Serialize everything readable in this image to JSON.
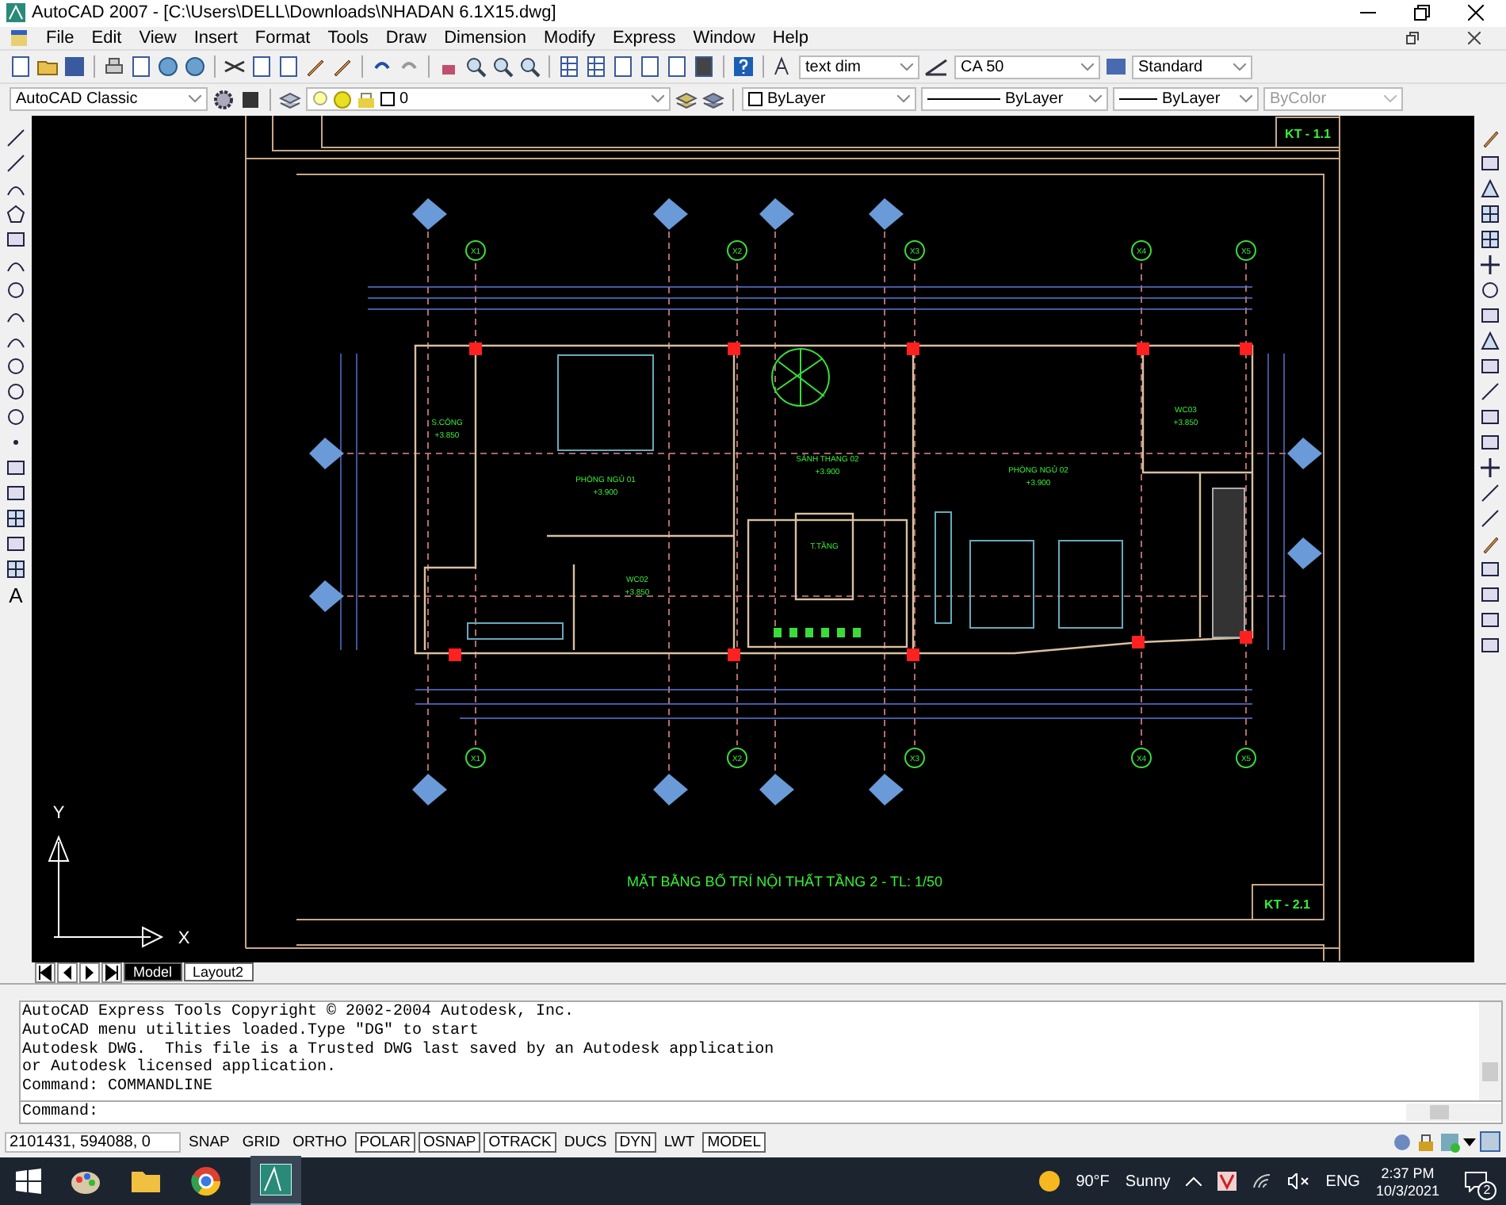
{
  "window": {
    "title": "AutoCAD 2007 - [C:\\Users\\DELL\\Downloads\\NHADAN 6.1X15.dwg]"
  },
  "menu": [
    "File",
    "Edit",
    "View",
    "Insert",
    "Format",
    "Tools",
    "Draw",
    "Dimension",
    "Modify",
    "Express",
    "Window",
    "Help"
  ],
  "styles": {
    "text_style": "text dim",
    "dim_style": "CA 50",
    "table_style": "Standard"
  },
  "properties": {
    "workspace": "AutoCAD Classic",
    "layer": "0",
    "color_control": "ByLayer",
    "linetype": "ByLayer",
    "lineweight": "ByLayer",
    "plot_style": "ByColor"
  },
  "draw_toolbar": {
    "text_tool": "A"
  },
  "drawing": {
    "sheet_top": "KT - 1.1",
    "sheet_bottom": "KT - 2.1",
    "title": "MẶT BẰNG BỐ TRÍ NỘI THẤT TẦNG 2 - TL: 1/50",
    "grid_x_top": [
      "X1",
      "X2",
      "X3",
      "X4",
      "X5"
    ],
    "grid_x_bottom": [
      "X1",
      "X2",
      "X3",
      "X4",
      "X5"
    ],
    "rooms": [
      {
        "name": "S.CÔNG",
        "elevation": "+3.850"
      },
      {
        "name": "PHÒNG NGỦ 01",
        "elevation": "+3.900"
      },
      {
        "name": "SẢNH THANG 02",
        "elevation": "+3.900"
      },
      {
        "name": "PHÒNG NGỦ 02",
        "elevation": "+3.900"
      },
      {
        "name": "WC02",
        "elevation": "+3.850"
      },
      {
        "name": "WC03",
        "elevation": "+3.850"
      }
    ],
    "stair_label": "T.TẦNG",
    "ucs": {
      "y": "Y",
      "x": "X"
    }
  },
  "tabs": [
    {
      "label": "Model",
      "selected": true
    },
    {
      "label": "Layout2",
      "selected": false
    }
  ],
  "command_history": [
    "AutoCAD Express Tools Copyright © 2002-2004 Autodesk, Inc.",
    "AutoCAD menu utilities loaded.Type \"DG\" to start",
    "Autodesk DWG.  This file is a Trusted DWG last saved by an Autodesk application",
    "or Autodesk licensed application.",
    "Command: COMMANDLINE"
  ],
  "command_prompt": "Command:",
  "status_bar": {
    "coordinates": "2101431, 594088, 0",
    "toggles": [
      {
        "label": "SNAP",
        "on": false
      },
      {
        "label": "GRID",
        "on": false
      },
      {
        "label": "ORTHO",
        "on": false
      },
      {
        "label": "POLAR",
        "on": true
      },
      {
        "label": "OSNAP",
        "on": true
      },
      {
        "label": "OTRACK",
        "on": true
      },
      {
        "label": "DUCS",
        "on": false
      },
      {
        "label": "DYN",
        "on": true
      },
      {
        "label": "LWT",
        "on": false
      },
      {
        "label": "MODEL",
        "on": true
      }
    ]
  },
  "taskbar": {
    "temperature": "90°F",
    "weather": "Sunny",
    "language": "ENG",
    "time": "2:37 PM",
    "date": "10/3/2021",
    "notifications": "2"
  }
}
